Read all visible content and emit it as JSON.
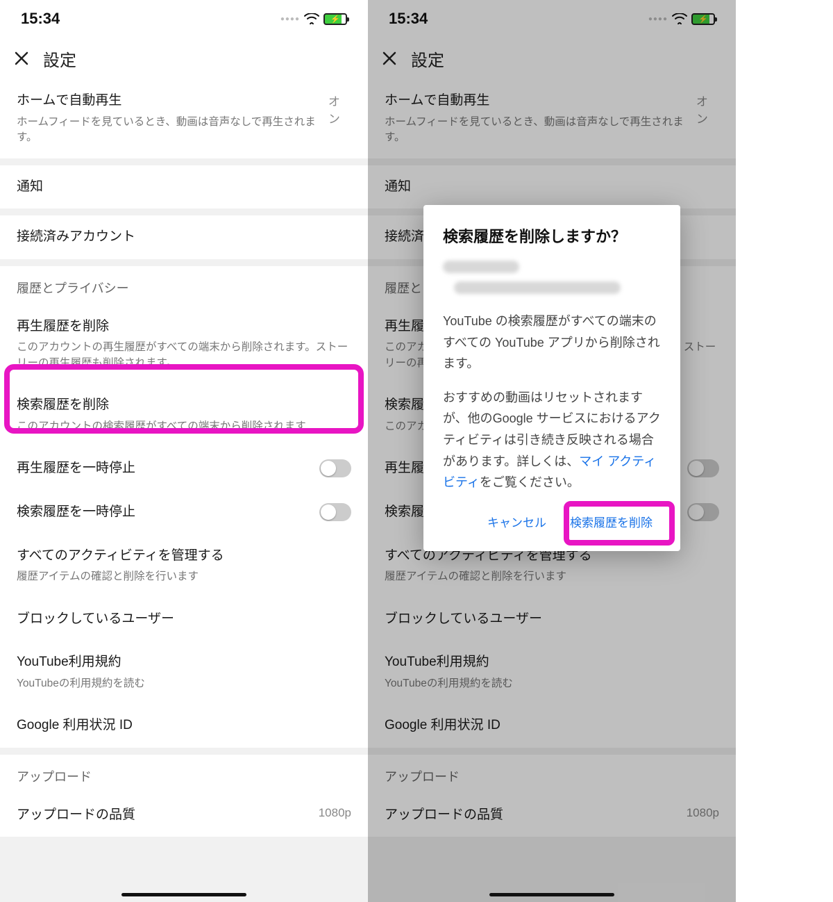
{
  "status": {
    "time": "15:34"
  },
  "header": {
    "title": "設定"
  },
  "rows": {
    "autoplay": {
      "title": "ホームで自動再生",
      "value": "オン",
      "sub": "ホームフィードを見ているとき、動画は音声なしで再生されます。"
    },
    "notifications": {
      "title": "通知"
    },
    "connected": {
      "title": "接続済みアカウント"
    },
    "privacy_section": "履歴とプライバシー",
    "clear_watch": {
      "title": "再生履歴を削除",
      "sub": "このアカウントの再生履歴がすべての端末から削除されます。ストーリーの再生履歴も削除されます。"
    },
    "clear_search": {
      "title": "検索履歴を削除",
      "sub": "このアカウントの検索履歴がすべての端末から削除されます"
    },
    "pause_watch": {
      "title": "再生履歴を一時停止"
    },
    "pause_search": {
      "title": "検索履歴を一時停止"
    },
    "manage_activity": {
      "title": "すべてのアクティビティを管理する",
      "sub": "履歴アイテムの確認と削除を行います"
    },
    "blocked": {
      "title": "ブロックしているユーザー"
    },
    "terms": {
      "title": "YouTube利用規約",
      "sub": "YouTubeの利用規約を読む"
    },
    "google_id": {
      "title": "Google 利用状況 ID"
    },
    "upload_section": "アップロード",
    "upload_quality": {
      "title": "アップロードの品質",
      "value": "1080p"
    }
  },
  "dialog": {
    "title": "検索履歴を削除しますか？",
    "body1": "YouTube の検索履歴がすべての端末のすべての YouTube アプリから削除されます。",
    "body2a": "おすすめの動画はリセットされますが、他のGoogle サービスにおけるアクティビティは引き続き反映される場合があります。詳しくは、",
    "body2_link": "マイ アクティビティ",
    "body2b": "をご覧ください。",
    "cancel": "キャンセル",
    "confirm": "検索履歴を削除"
  }
}
